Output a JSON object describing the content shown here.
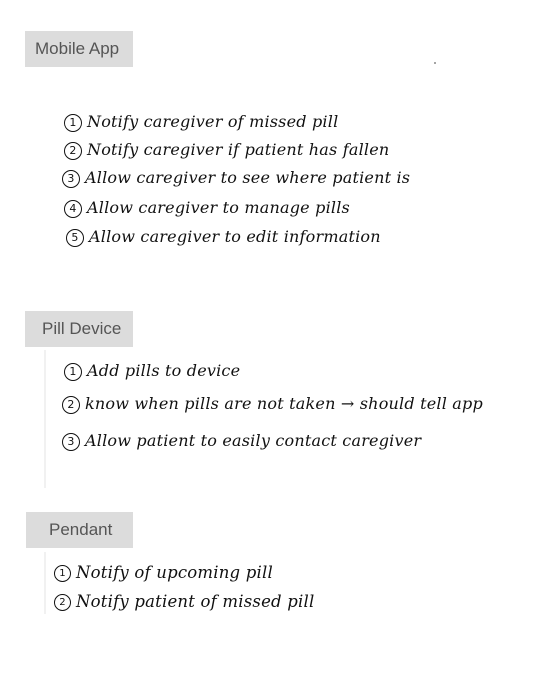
{
  "sections": [
    {
      "title": "Mobile App",
      "items": [
        {
          "num": "1",
          "text": "Notify caregiver of missed pill"
        },
        {
          "num": "2",
          "text": "Notify caregiver if patient has fallen"
        },
        {
          "num": "3",
          "text": "Allow caregiver to see where patient is"
        },
        {
          "num": "4",
          "text": "Allow caregiver to manage pills"
        },
        {
          "num": "5",
          "text": "Allow caregiver to edit information"
        }
      ]
    },
    {
      "title": "Pill Device",
      "items": [
        {
          "num": "1",
          "text": "Add pills to device"
        },
        {
          "num": "2",
          "text": "know when pills are not taken → should tell app"
        },
        {
          "num": "3",
          "text": "Allow patient to easily contact caregiver"
        }
      ]
    },
    {
      "title": "Pendant",
      "items": [
        {
          "num": "1",
          "text": "Notify of upcoming pill"
        },
        {
          "num": "2",
          "text": "Notify patient of missed pill"
        }
      ]
    }
  ]
}
